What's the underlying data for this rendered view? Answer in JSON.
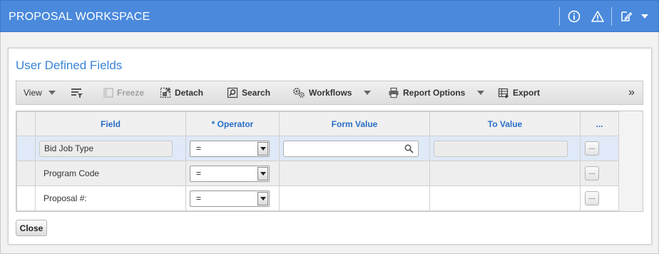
{
  "app": {
    "title": "PROPOSAL WORKSPACE"
  },
  "header_icons": [
    "info-icon",
    "warning-icon",
    "edit-icon",
    "dropdown-caret-icon"
  ],
  "panel": {
    "title": "User Defined Fields"
  },
  "toolbar": {
    "view": "View",
    "freeze": "Freeze",
    "detach": "Detach",
    "search": "Search",
    "workflows": "Workflows",
    "report_options": "Report Options",
    "export": "Export",
    "overflow": "»"
  },
  "grid": {
    "columns": [
      "Field",
      "* Operator",
      "Form Value",
      "To Value",
      "..."
    ],
    "rows": [
      {
        "field": "Bid Job Type",
        "operator": "=",
        "form_value": "",
        "selected": true
      },
      {
        "field": "Program Code",
        "operator": "=",
        "form_value": ""
      },
      {
        "field": "Proposal #:",
        "operator": "=",
        "form_value": ""
      }
    ],
    "row_button": "..."
  },
  "footer": {
    "close": "Close"
  },
  "colors": {
    "header_bg": "#4a89dc",
    "accent": "#3a85d6",
    "selected_row": "#dfe9f7"
  }
}
